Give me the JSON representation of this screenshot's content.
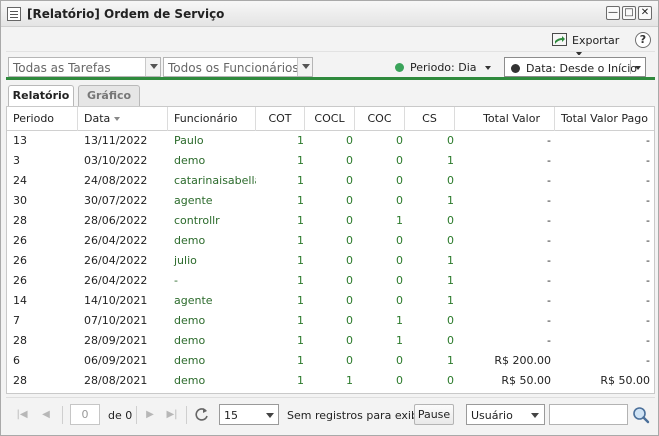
{
  "window": {
    "title": "[Relatório] Ordem de Serviço"
  },
  "toolbar": {
    "export_label": "Exportar",
    "help_icon": "help-icon"
  },
  "filters": {
    "tasks": "Todas as Tarefas",
    "employees": "Todos os Funcionários",
    "period_label": "Periodo: Dia",
    "period_color": "#3aa35a",
    "date_label": "Data: Desde o Início",
    "date_color": "#333333",
    "accent": "#2f8a3d"
  },
  "tabs": [
    {
      "label": "Relatório",
      "active": true
    },
    {
      "label": "Gráfico",
      "active": false
    }
  ],
  "table": {
    "columns": [
      "Periodo",
      "Data",
      "Funcionário",
      "COT",
      "COCL",
      "COC",
      "CS",
      "Total Valor",
      "Total Valor Pago"
    ],
    "rows": [
      [
        "13",
        "13/11/2022",
        "Paulo",
        "1",
        "0",
        "0",
        "0",
        "-",
        "-"
      ],
      [
        "3",
        "03/10/2022",
        "demo",
        "1",
        "0",
        "0",
        "1",
        "-",
        "-"
      ],
      [
        "24",
        "24/08/2022",
        "catarinaisabella",
        "1",
        "0",
        "0",
        "0",
        "-",
        "-"
      ],
      [
        "30",
        "30/07/2022",
        "agente",
        "1",
        "0",
        "0",
        "1",
        "-",
        "-"
      ],
      [
        "28",
        "28/06/2022",
        "controllr",
        "1",
        "0",
        "1",
        "0",
        "-",
        "-"
      ],
      [
        "26",
        "26/04/2022",
        "demo",
        "1",
        "0",
        "0",
        "0",
        "-",
        "-"
      ],
      [
        "26",
        "26/04/2022",
        "julio",
        "1",
        "0",
        "0",
        "1",
        "-",
        "-"
      ],
      [
        "26",
        "26/04/2022",
        "-",
        "1",
        "0",
        "0",
        "1",
        "-",
        "-"
      ],
      [
        "14",
        "14/10/2021",
        "agente",
        "1",
        "0",
        "0",
        "1",
        "-",
        "-"
      ],
      [
        "7",
        "07/10/2021",
        "demo",
        "1",
        "0",
        "1",
        "0",
        "-",
        "-"
      ],
      [
        "28",
        "28/09/2021",
        "demo",
        "1",
        "0",
        "1",
        "0",
        "-",
        "-"
      ],
      [
        "6",
        "06/09/2021",
        "demo",
        "1",
        "0",
        "0",
        "1",
        "R$ 200.00",
        "-"
      ],
      [
        "28",
        "28/08/2021",
        "demo",
        "1",
        "1",
        "0",
        "0",
        "R$ 50.00",
        "R$ 50.00"
      ]
    ]
  },
  "pagination": {
    "page": "0",
    "of_label": "de 0",
    "page_size": "15",
    "status": "Sem registros para exibir",
    "pause_label": "Pause"
  },
  "search": {
    "field": "Usuário",
    "value": ""
  }
}
